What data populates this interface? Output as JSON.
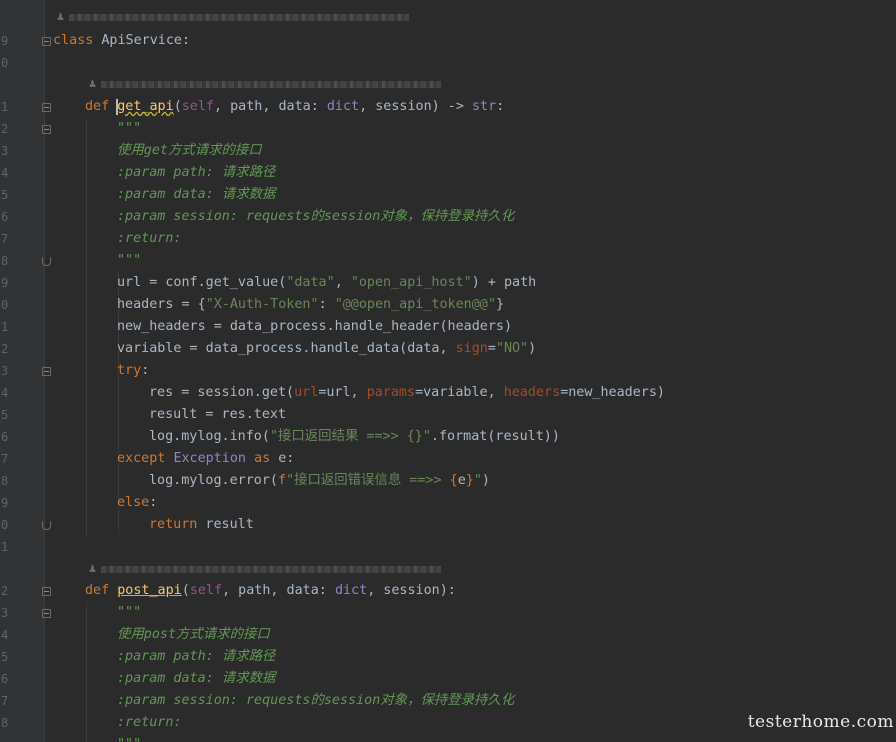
{
  "gutter": {
    "line_numbers": [
      "9",
      "0",
      "",
      "1",
      "2",
      "3",
      "4",
      "5",
      "6",
      "7",
      "8",
      "9",
      "0",
      "1",
      "2",
      "3",
      "4",
      "5",
      "6",
      "7",
      "8",
      "9",
      "0",
      "1",
      "",
      "2",
      "3",
      "4",
      "5",
      "6",
      "7",
      "8"
    ]
  },
  "blame": {
    "icon": "person-icon",
    "top": "",
    "get_api": "",
    "post_api": ""
  },
  "code": {
    "class_kw": "class",
    "class_name": "ApiService:",
    "get": {
      "def_kw": "def",
      "name": "get_api",
      "open": "(",
      "self": "self",
      "args1": ", path, data: ",
      "dict": "dict",
      "args2": ", session) -> ",
      "str": "str",
      "colon": ":",
      "doc_open": "\"\"\"",
      "doc_line1": "使用get方式请求的接口",
      "doc_path": ":param path: 请求路径",
      "doc_data": ":param data: 请求数据",
      "doc_session": ":param session: requests的session对象，保持登录持久化",
      "doc_return": ":return:",
      "doc_close": "\"\"\"",
      "url_a": "url = conf.get_value(",
      "url_s1": "\"data\"",
      "url_b": ", ",
      "url_s2": "\"open_api_host\"",
      "url_c": ") + path",
      "headers_a": "headers = {",
      "headers_s1": "\"X-Auth-Token\"",
      "headers_b": ": ",
      "headers_s2": "\"@@open_api_token@@\"",
      "headers_c": "}",
      "new_headers": "new_headers = data_process.handle_header(headers)",
      "variable_a": "variable = data_process.handle_data(data, ",
      "variable_kw": "sign",
      "variable_b": "=",
      "variable_s": "\"NO\"",
      "variable_c": ")",
      "try_kw": "try",
      "try_colon": ":",
      "res_a": "res = session.get(",
      "res_p1": "url",
      "res_b": "=url, ",
      "res_p2": "params",
      "res_c": "=variable, ",
      "res_p3": "headers",
      "res_d": "=new_headers)",
      "result_line": "result = res.text",
      "log_info_a": "log.mylog.info(",
      "log_info_s": "\"接口返回结果 ==>> {}\"",
      "log_info_b": ".format(result))",
      "except_kw": "except",
      "exception": "Exception",
      "as_kw": "as",
      "except_tail": " e:",
      "log_err_a": "log.mylog.error(",
      "log_err_f": "f",
      "log_err_s1": "\"接口返回错误信息 ==>> ",
      "log_err_brace1": "{",
      "log_err_e": "e",
      "log_err_brace2": "}",
      "log_err_s2": "\"",
      "log_err_b": ")",
      "else_kw": "else",
      "else_colon": ":",
      "return_kw": "return",
      "return_val": " result"
    },
    "post": {
      "def_kw": "def",
      "name": "post_api",
      "open": "(",
      "self": "self",
      "args1": ", path, data: ",
      "dict": "dict",
      "args2": ", session):",
      "doc_open": "\"\"\"",
      "doc_line1": "使用post方式请求的接口",
      "doc_path": ":param path: 请求路径",
      "doc_data": ":param data: 请求数据",
      "doc_session": ":param session: requests的session对象，保持登录持久化",
      "doc_return": ":return:",
      "doc_close": "\"\"\""
    }
  },
  "watermark": "testerhome.com",
  "colors": {
    "background": "#2b2b2b",
    "keyword": "#cc7832",
    "function": "#ffc66d",
    "string": "#6a8759",
    "self": "#94558d",
    "builtin": "#8888c6"
  }
}
